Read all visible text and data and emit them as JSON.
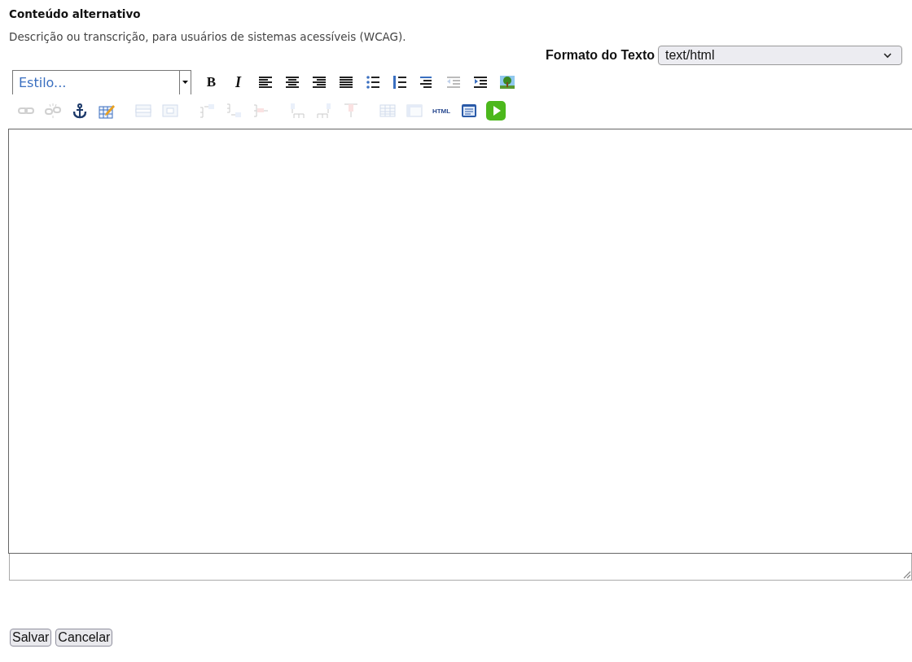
{
  "heading": "Conteúdo alternativo",
  "description": "Descrição ou transcrição, para usuários de sistemas acessíveis (WCAG).",
  "format": {
    "label": "Formato do Texto",
    "value": "text/html"
  },
  "style_select": {
    "placeholder": "Estilo..."
  },
  "toolbar_rows": [
    [
      [
        {
          "kind": "bold",
          "label": "B",
          "disabled": false
        },
        {
          "kind": "italic",
          "label": "I",
          "disabled": false
        },
        {
          "kind": "align-left",
          "disabled": false
        },
        {
          "kind": "align-center",
          "disabled": false
        },
        {
          "kind": "align-right",
          "disabled": false
        },
        {
          "kind": "justify",
          "disabled": false
        },
        {
          "kind": "bullets",
          "disabled": false
        },
        {
          "kind": "numbers",
          "disabled": false
        },
        {
          "kind": "definition",
          "disabled": false
        },
        {
          "kind": "outdent",
          "disabled": true
        },
        {
          "kind": "indent",
          "disabled": false
        },
        {
          "kind": "image",
          "disabled": false
        }
      ]
    ],
    [
      [
        {
          "kind": "link",
          "disabled": true
        },
        {
          "kind": "unlink",
          "disabled": true
        },
        {
          "kind": "anchor",
          "disabled": false
        },
        {
          "kind": "table-edit",
          "disabled": false
        }
      ],
      [
        {
          "kind": "row",
          "disabled": true
        },
        {
          "kind": "cell",
          "disabled": true
        }
      ],
      [
        {
          "kind": "row-before",
          "disabled": true
        },
        {
          "kind": "row-after",
          "disabled": true
        },
        {
          "kind": "row-delete",
          "disabled": true
        }
      ],
      [
        {
          "kind": "col-before",
          "disabled": true
        },
        {
          "kind": "col-after",
          "disabled": true
        },
        {
          "kind": "col-delete",
          "disabled": true
        }
      ],
      [
        {
          "kind": "table",
          "disabled": true
        },
        {
          "kind": "table-props",
          "disabled": true
        },
        {
          "kind": "html",
          "label": "HTML",
          "disabled": false
        },
        {
          "kind": "window",
          "disabled": false
        },
        {
          "kind": "play",
          "disabled": false
        }
      ]
    ]
  ],
  "buttons": [
    {
      "label": "Salvar"
    },
    {
      "label": "Cancelar"
    }
  ]
}
